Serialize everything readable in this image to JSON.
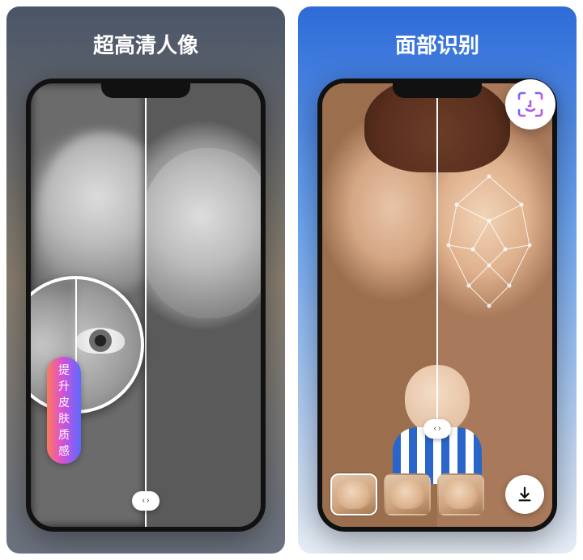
{
  "panels": {
    "left": {
      "title": "超高清人像",
      "badge_label": "提升皮肤质感"
    },
    "right": {
      "title": "面部识别"
    }
  },
  "icons": {
    "slider_left": "‹",
    "slider_right": "›",
    "faceid": "face-id",
    "download": "download"
  },
  "thumbnails": [
    {
      "id": "group",
      "selected": true
    },
    {
      "id": "baby",
      "selected": false
    },
    {
      "id": "woman",
      "selected": false
    }
  ],
  "colors": {
    "gradient_badge_start": "#ff7a59",
    "gradient_badge_mid": "#d84fd8",
    "gradient_badge_end": "#5a6bff"
  }
}
